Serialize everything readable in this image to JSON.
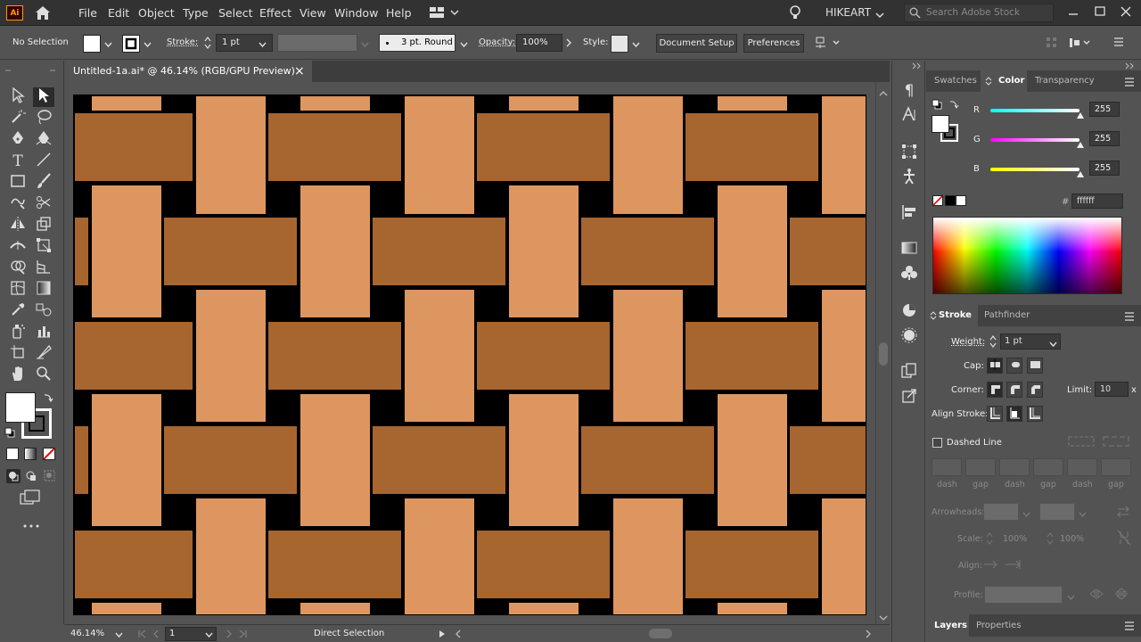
{
  "menubar": {
    "items": [
      "File",
      "Edit",
      "Object",
      "Type",
      "Select",
      "Effect",
      "View",
      "Window",
      "Help"
    ],
    "workspace": "HIKEART",
    "search_placeholder": "Search Adobe Stock",
    "app_logo": "Ai"
  },
  "control": {
    "selection_status": "No Selection",
    "stroke_label": "Stroke:",
    "stroke_weight": "1 pt",
    "brush": "3 pt. Round",
    "opacity_label": "Opacity:",
    "opacity_value": "100%",
    "style_label": "Style:",
    "document_setup": "Document Setup",
    "preferences": "Preferences"
  },
  "document": {
    "tab_title": "Untitled-1a.ai* @ 46.14% (RGB/GPU Preview)",
    "close": "×"
  },
  "status": {
    "zoom": "46.14%",
    "artboard_number": "1",
    "tool": "Direct Selection"
  },
  "color_panel": {
    "tabs": [
      "Swatches",
      "Color",
      "Transparency"
    ],
    "active_tab": "Color",
    "r_label": "R",
    "g_label": "G",
    "b_label": "B",
    "r": "255",
    "g": "255",
    "b": "255",
    "hash": "#",
    "hex": "ffffff"
  },
  "stroke_panel": {
    "tabs": [
      "Stroke",
      "Pathfinder"
    ],
    "active_tab": "Stroke",
    "weight_label": "Weight:",
    "weight": "1 pt",
    "cap_label": "Cap:",
    "corner_label": "Corner:",
    "limit_label": "Limit:",
    "limit": "10",
    "limit_unit": "x",
    "align_label": "Align Stroke:",
    "dashed_line": "Dashed Line",
    "dash_labels": [
      "dash",
      "gap",
      "dash",
      "gap",
      "dash",
      "gap"
    ],
    "arrowheads_label": "Arrowheads:",
    "scale_label": "Scale:",
    "scale_values": [
      "100%",
      "100%"
    ],
    "align_label2": "Align:",
    "profile_label": "Profile:"
  },
  "bottom_panel": {
    "tabs": [
      "Layers",
      "Properties"
    ],
    "active_tab": "Layers"
  },
  "colors": {
    "ui_dark": "#323232",
    "ui_mid": "#535353",
    "light_strip": "#de9661",
    "dark_strip": "#a7652f",
    "background": "#000000"
  }
}
